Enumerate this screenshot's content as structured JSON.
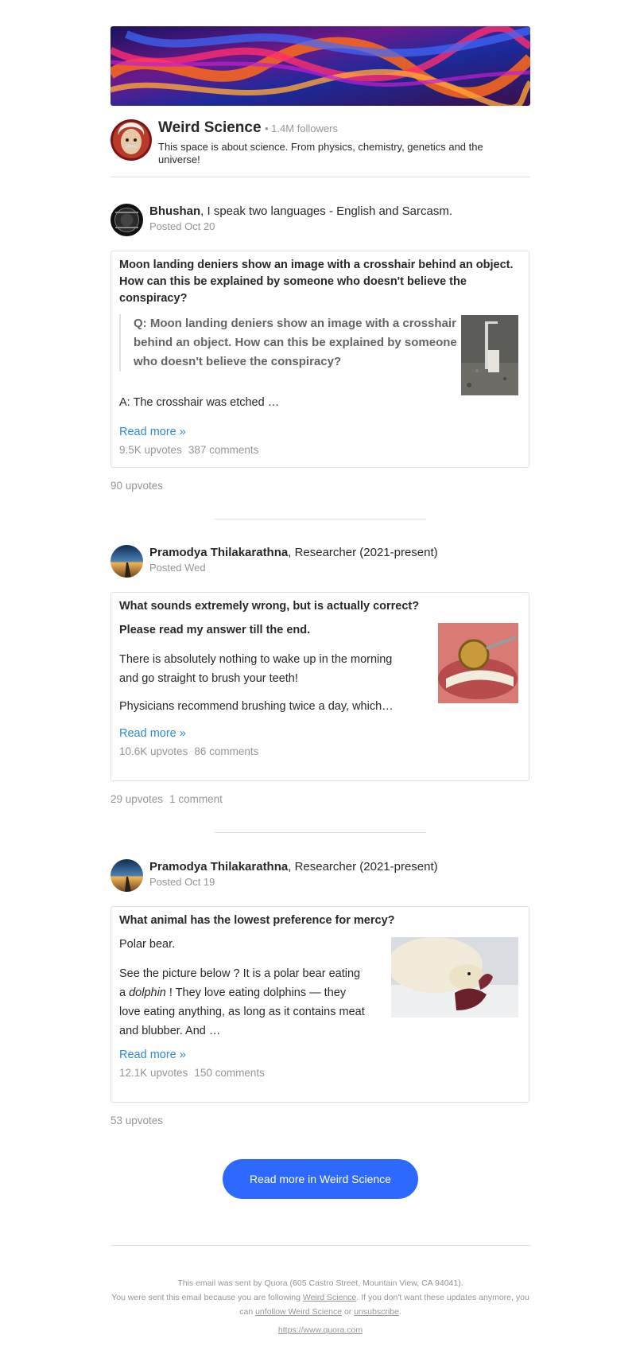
{
  "space": {
    "name": "Weird Science",
    "followers": "• 1.4M followers",
    "description": "This space is about science. From physics, chemistry, genetics and the universe!"
  },
  "posts": [
    {
      "author": "Bhushan",
      "credential": ", I speak two languages - English and Sarcasm.",
      "date": "Posted Oct 20",
      "question": "Moon landing deniers show an image with a crosshair behind an object. How can this be explained by someone who doesn't believe the conspiracy?",
      "quote": "Q: Moon landing deniers show an image with a crosshair behind an object. How can this be explained by someone who doesn't believe the conspiracy?",
      "excerpt": "A: The crosshair was etched …",
      "read_more": "Read more »",
      "card_upvotes": "9.5K upvotes",
      "card_comments": "387 comments",
      "post_upvotes": "90 upvotes",
      "post_comments": "",
      "thumb_icon": "moon-photo-thumbnail"
    },
    {
      "author": "Pramodya Thilakarathna",
      "credential": ", Researcher (2021-present)",
      "date": "Posted Wed",
      "question": "What sounds extremely wrong, but is actually correct?",
      "lead": "Please read my answer till the end.",
      "paragraph1": "There is absolutely nothing to wake up in the morning and go straight to brush your teeth!",
      "paragraph2": "Physicians recommend brushing twice a day, which…",
      "read_more": "Read more »",
      "card_upvotes": "10.6K upvotes",
      "card_comments": "86 comments",
      "post_upvotes": "29 upvotes",
      "post_comments": "1 comment",
      "thumb_icon": "teeth-photo-thumbnail"
    },
    {
      "author": "Pramodya Thilakarathna",
      "credential": ", Researcher (2021-present)",
      "date": "Posted Oct 19",
      "question": "What animal has the lowest preference for mercy?",
      "lead": "Polar bear.",
      "paragraph_before": "See the picture below ? It is a polar bear eating a ",
      "paragraph_italic": "dolphin",
      "paragraph_after": " ! They love eating dolphins — they love eating anything, as long as it contains meat and blubber. And …",
      "read_more": "Read more »",
      "card_upvotes": "12.1K upvotes",
      "card_comments": "150 comments",
      "post_upvotes": "53 upvotes",
      "post_comments": "",
      "thumb_icon": "polar-bear-photo-thumbnail"
    }
  ],
  "cta": {
    "label": "Read more in Weird Science"
  },
  "footer": {
    "line1": "This email was sent by Quora (605 Castro Street, Mountain View, CA 94041).",
    "line2_before": "You were sent this email because you are following ",
    "line2_link": "Weird Science",
    "line2_after": ". If you don't want these updates anymore, you can ",
    "unfollow_link": "unfollow Weird Science",
    "or": " or ",
    "unsubscribe_link": "unsubscribe",
    "period": ".",
    "url": "https://www.quora.com"
  },
  "colors": {
    "accent": "#2e69ff",
    "link": "#2b8bd8",
    "muted": "#939598",
    "border": "#dee0e1"
  }
}
